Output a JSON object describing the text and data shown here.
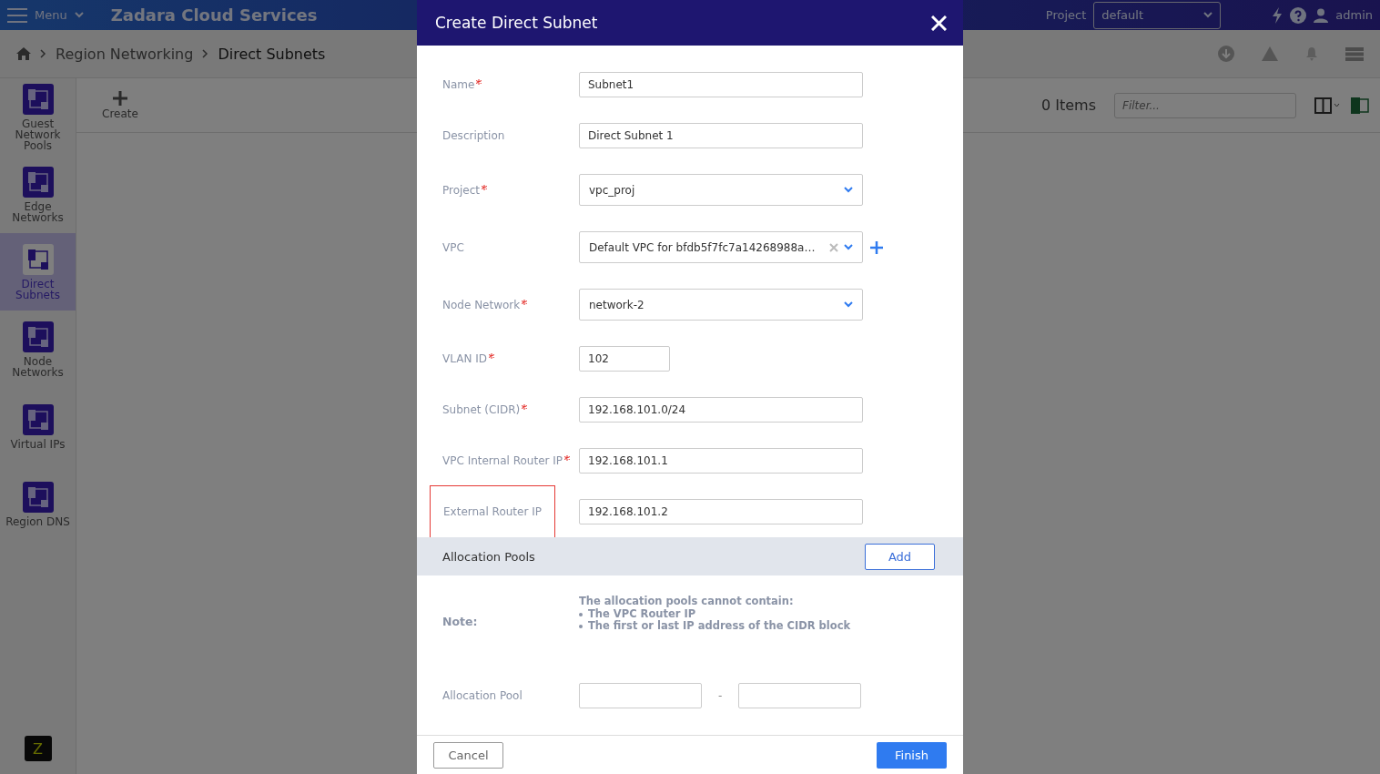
{
  "topbar": {
    "menu": "Menu",
    "brand": "Zadara Cloud Services",
    "project_label": "Project",
    "project": "default",
    "user": "admin"
  },
  "breadcrumb": [
    "Region Networking",
    "Direct Subnets"
  ],
  "sidebar": {
    "items": [
      {
        "label": "Guest Network Pools",
        "selected": false
      },
      {
        "label": "Edge Networks",
        "selected": false
      },
      {
        "label": "Direct Subnets",
        "selected": true
      },
      {
        "label": "Node Networks",
        "selected": false
      },
      {
        "label": "Virtual IPs",
        "selected": false
      },
      {
        "label": "Region DNS",
        "selected": false
      }
    ],
    "logo": "Z"
  },
  "toolbar": {
    "create": "Create",
    "count": "0 Items",
    "filter_placeholder": "Filter..."
  },
  "dialog": {
    "title": "Create Direct Subnet",
    "fields": [
      {
        "kind": "text",
        "label": "Name",
        "required": true,
        "value": "Subnet1",
        "highlighted": false
      },
      {
        "kind": "text",
        "label": "Description",
        "required": false,
        "value": "Direct Subnet 1",
        "highlighted": false
      },
      {
        "kind": "select",
        "label": "Project",
        "required": true,
        "value": "vpc_proj",
        "clearable": false,
        "addable": false,
        "highlighted": false
      },
      {
        "kind": "select",
        "label": "VPC",
        "required": false,
        "value": "Default VPC for bfdb5f7fc7a14268988a…",
        "clearable": true,
        "addable": true,
        "highlighted": false
      },
      {
        "kind": "select",
        "label": "Node Network",
        "required": true,
        "value": "network-2",
        "clearable": false,
        "addable": false,
        "highlighted": false
      },
      {
        "kind": "short",
        "label": "VLAN ID",
        "required": true,
        "value": "102",
        "highlighted": false
      },
      {
        "kind": "text",
        "label": "Subnet (CIDR)",
        "required": true,
        "value": "192.168.101.0/24",
        "highlighted": false
      },
      {
        "kind": "text",
        "label": "VPC Internal Router IP",
        "required": true,
        "value": "192.168.101.1",
        "highlighted": false
      },
      {
        "kind": "text",
        "label": "External Router IP",
        "required": false,
        "value": "192.168.101.2",
        "highlighted": true
      }
    ],
    "pools_section": {
      "title": "Allocation Pools",
      "add": "Add"
    },
    "note": {
      "label": "Note:",
      "intro": "The allocation pools cannot contain:",
      "items": [
        "The VPC Router IP",
        "The first or last IP address of the CIDR block"
      ]
    },
    "pool_row": {
      "label": "Allocation Pool",
      "separator": "-"
    },
    "cancel": "Cancel",
    "finish": "Finish"
  }
}
